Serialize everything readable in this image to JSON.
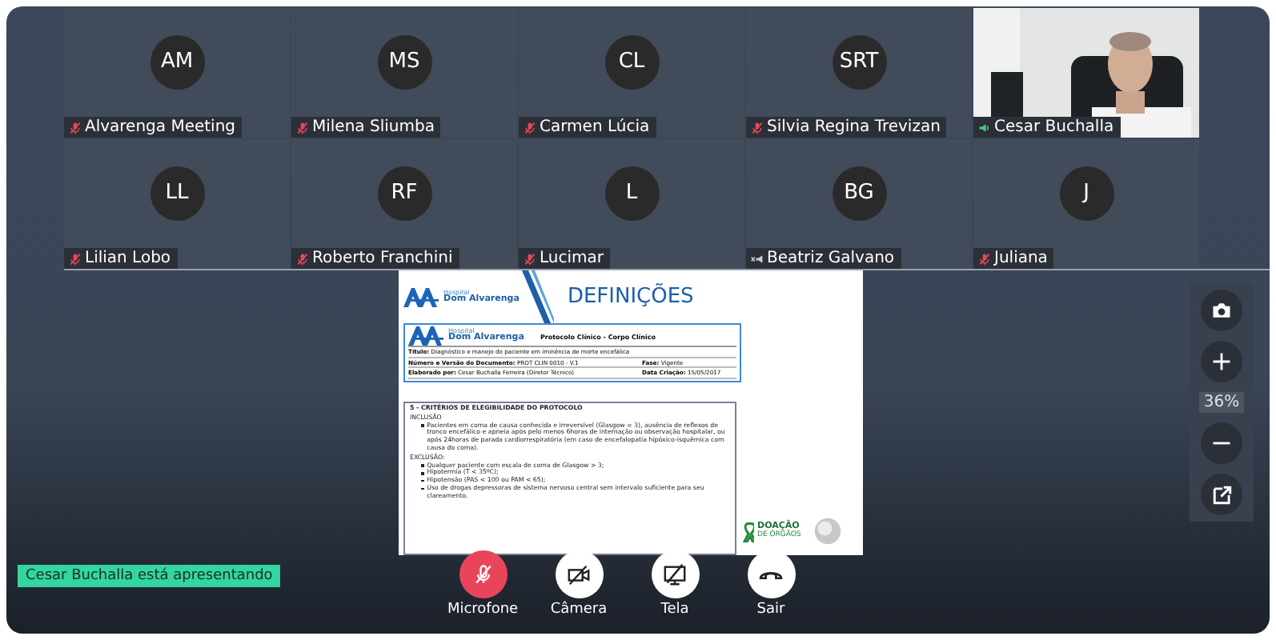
{
  "participants": [
    {
      "name": "Alvarenga Meeting",
      "initials": "AM",
      "muted": true,
      "audio_connected": true,
      "kind": "avatar"
    },
    {
      "name": "Milena Sliumba",
      "initials": "MS",
      "muted": true,
      "audio_connected": true,
      "kind": "avatar"
    },
    {
      "name": "Carmen Lúcia",
      "initials": "CL",
      "muted": true,
      "audio_connected": true,
      "kind": "avatar"
    },
    {
      "name": "Silvia Regina Trevizan",
      "initials": "SRT",
      "muted": true,
      "audio_connected": true,
      "kind": "avatar"
    },
    {
      "name": "Cesar Buchalla",
      "muted": false,
      "audio_connected": true,
      "kind": "video"
    },
    {
      "name": "Lilian Lobo",
      "initials": "LL",
      "muted": true,
      "audio_connected": true,
      "kind": "avatar"
    },
    {
      "name": "Roberto Franchini",
      "initials": "RF",
      "muted": true,
      "audio_connected": true,
      "kind": "avatar"
    },
    {
      "name": "Lucimar",
      "initials": "L",
      "muted": true,
      "audio_connected": true,
      "kind": "avatar"
    },
    {
      "name": "Beatriz Galvano",
      "initials": "BG",
      "muted": false,
      "audio_connected": false,
      "kind": "avatar"
    },
    {
      "name": "Juliana",
      "initials": "J",
      "muted": true,
      "audio_connected": true,
      "kind": "avatar"
    }
  ],
  "slide": {
    "logo_top": "Hospital",
    "logo_name": "Dom Alvarenga",
    "title": "DEFINIÇÕES",
    "protocol": {
      "logo_top": "Hospital",
      "logo_name": "Dom Alvarenga",
      "heading": "Protocolo Clínico - Corpo Clínico",
      "rows": [
        [
          {
            "label": "Título:",
            "value": "Diagnóstico e manejo do paciente em iminência de morte encefálica"
          }
        ],
        [
          {
            "label": "Número e Versão do Documento:",
            "value": "PROT CLIN 0010 - V.1"
          },
          {
            "label": "Fase:",
            "value": "Vigente"
          }
        ],
        [
          {
            "label": "Elaborado por:",
            "value": "Cesar Buchalla Ferreira (Diretor Técnico)"
          },
          {
            "label": "Data Criação:",
            "value": "15/05/2017"
          }
        ]
      ]
    },
    "section_title": "5 - CRITÉRIOS DE ELEGIBILIDADE DO PROTOCOLO",
    "groups": [
      {
        "heading": "INCLUSÃO",
        "items": [
          "Pacientes em coma de causa conhecida e irreversível (Glasgow = 3), ausência de reflexos de tronco encefálico e apneia após pelo menos 6horas de internação ou observação hospitalar, ou após 24horas de parada cardiorrespiratória (em caso de encefalopatia hipóxico-isquêmica com causa do coma)."
        ]
      },
      {
        "heading": "EXCLUSÃO:",
        "items": [
          "Qualquer paciente com escala de coma de Glasgow > 3;",
          "Hipotermia (T < 35ºC);",
          "Hipotensão (PAS < 100 ou PAM < 65);",
          "Uso de drogas depressoras de sistema nervoso central sem intervalo suficiente para seu clareamento."
        ]
      }
    ],
    "badge_line1": "DOAÇÃO",
    "badge_line2": "DE ÓRGÃOS"
  },
  "zoom": {
    "reading": "36%"
  },
  "presenter_banner": "Cesar Buchalla está apresentando",
  "controls": [
    {
      "label": "Microfone",
      "kind": "mic",
      "highlighted": true
    },
    {
      "label": "Câmera",
      "kind": "camera",
      "highlighted": false
    },
    {
      "label": "Tela",
      "kind": "screen",
      "highlighted": false
    },
    {
      "label": "Sair",
      "kind": "leave",
      "highlighted": false
    }
  ]
}
